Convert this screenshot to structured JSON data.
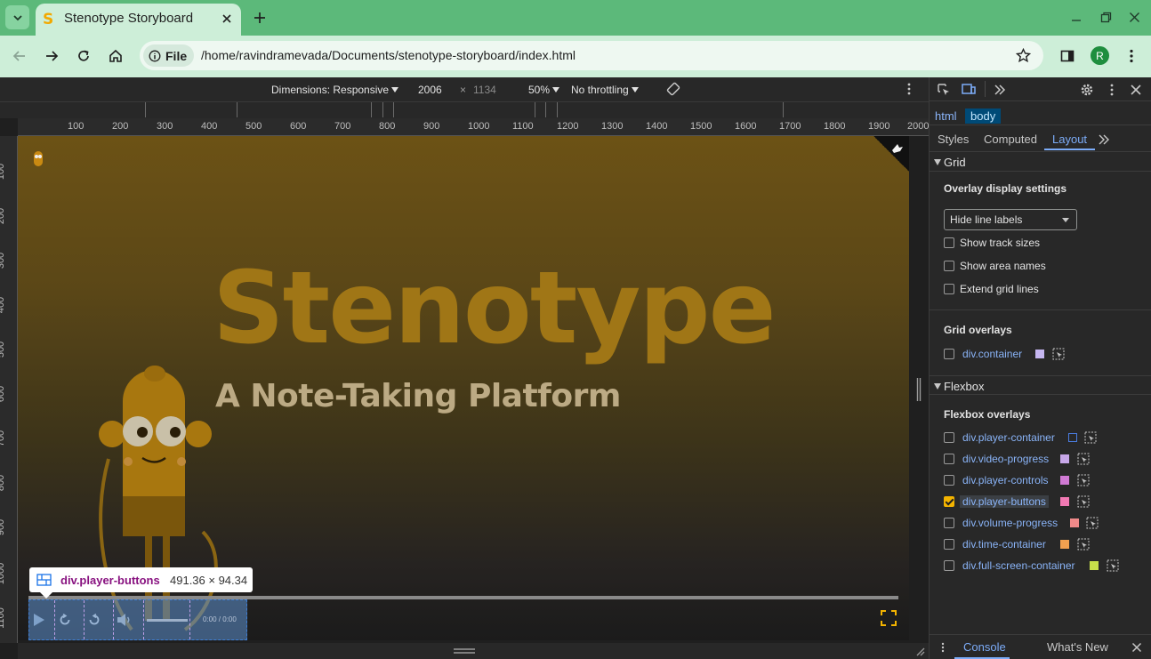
{
  "browser": {
    "tab_title": "Stenotype Storyboard",
    "tab_favicon": "S",
    "site_chip": "File",
    "url": "/home/ravindramevada/Documents/stenotype-storyboard/index.html",
    "profile_initial": "R",
    "theme_color": "#5cb97a"
  },
  "device_toolbar": {
    "dimensions_label": "Dimensions: Responsive",
    "width": "2006",
    "times": "×",
    "height": "1134",
    "zoom": "50%",
    "throttling": "No throttling"
  },
  "rulers": {
    "top": [
      "100",
      "200",
      "300",
      "400",
      "500",
      "600",
      "700",
      "800",
      "900",
      "1000",
      "1100",
      "1200",
      "1300",
      "1400",
      "1500",
      "1600",
      "1700",
      "1800",
      "1900",
      "2000"
    ],
    "left": [
      "100",
      "200",
      "300",
      "400",
      "500",
      "600",
      "700",
      "800",
      "900",
      "1000",
      "1100"
    ]
  },
  "page": {
    "title": "Stenotype",
    "subtitle": "A Note-Taking Platform",
    "time": "0:00 / 0:00",
    "accent": "#f4b400"
  },
  "tooltip": {
    "element": "div.player-buttons",
    "size": "491.36 × 94.34"
  },
  "devtools": {
    "breadcrumbs": [
      "html",
      "body"
    ],
    "tabs": [
      "Styles",
      "Computed",
      "Layout"
    ],
    "active_tab": "Layout",
    "grid": {
      "header": "Grid",
      "overlay_settings": "Overlay display settings",
      "line_labels": "Hide line labels",
      "options": [
        {
          "label": "Show track sizes",
          "checked": false
        },
        {
          "label": "Show area names",
          "checked": false
        },
        {
          "label": "Extend grid lines",
          "checked": false
        }
      ],
      "overlays_header": "Grid overlays",
      "overlays": [
        {
          "label": "div.container",
          "color": "#c5b6f0",
          "checked": false
        }
      ]
    },
    "flexbox": {
      "header": "Flexbox",
      "overlays_header": "Flexbox overlays",
      "overlays": [
        {
          "label": "div.player-container",
          "color": "#2a4a9a",
          "checked": false
        },
        {
          "label": "div.video-progress",
          "color": "#c7a7e8",
          "checked": false
        },
        {
          "label": "div.player-controls",
          "color": "#d07ad4",
          "checked": false
        },
        {
          "label": "div.player-buttons",
          "color": "#f27ab4",
          "checked": true
        },
        {
          "label": "div.volume-progress",
          "color": "#f08a8a",
          "checked": false
        },
        {
          "label": "div.time-container",
          "color": "#f0a050",
          "checked": false
        },
        {
          "label": "div.full-screen-container",
          "color": "#c8e04a",
          "checked": false
        }
      ]
    },
    "drawer_tabs": [
      "Console",
      "What's New"
    ]
  }
}
